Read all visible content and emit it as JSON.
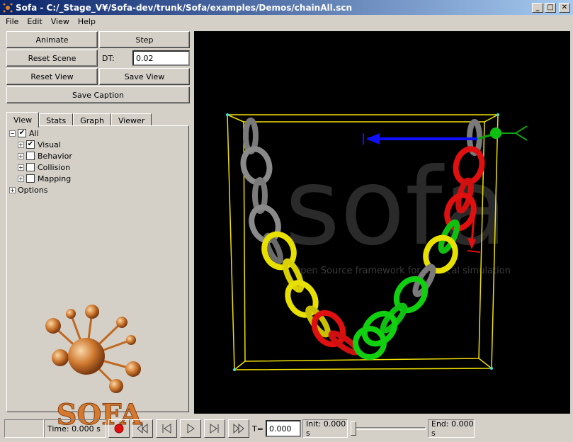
{
  "window": {
    "title": "Sofa - C:/_Stage_V¥/Sofa-dev/trunk/Sofa/examples/Demos/chainAll.scn"
  },
  "menu": [
    "File",
    "Edit",
    "View",
    "Help"
  ],
  "controls": {
    "animate": "Animate",
    "step": "Step",
    "reset_scene": "Reset Scene",
    "dt_label": "DT:",
    "dt_value": "0.02",
    "reset_view": "Reset View",
    "save_view": "Save View",
    "save_caption": "Save Caption"
  },
  "tabs": [
    "View",
    "Stats",
    "Graph",
    "Viewer"
  ],
  "tree": {
    "all": "All",
    "visual": "Visual",
    "behavior": "Behavior",
    "collision": "Collision",
    "mapping": "Mapping",
    "options": "Options"
  },
  "logo": {
    "text": "SOFA"
  },
  "viewport": {
    "watermark": "sofa",
    "watermark_sub": "Open Source framework for medical simulation"
  },
  "status": {
    "time": "Time: 0.000 s",
    "t_label": "T=",
    "t_value": "0.000",
    "init": "Init: 0.000 s",
    "end": "End: 0.000 s"
  }
}
